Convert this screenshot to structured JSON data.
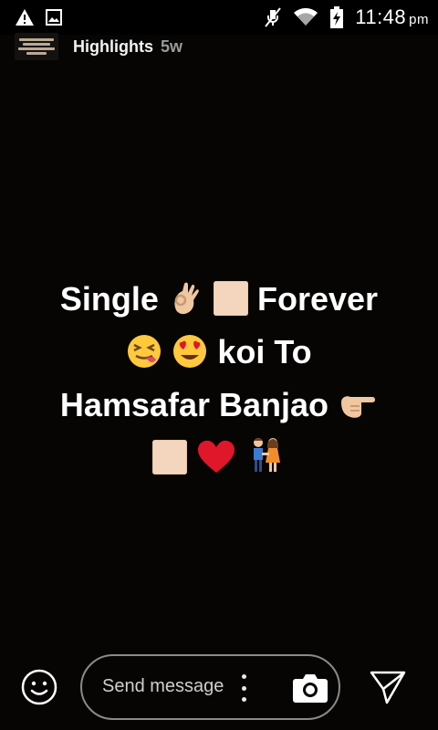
{
  "status_bar": {
    "time": "11:48",
    "ampm": "pm",
    "icons": [
      "warning-icon",
      "image-icon",
      "mute-icon",
      "wifi-icon",
      "battery-charging-icon"
    ]
  },
  "header": {
    "title": "Highlights",
    "age": "5w"
  },
  "story": {
    "line1_a": "Single",
    "line1_b": "Forever",
    "line2": "koi To",
    "line3": "Hamsafar Banjao"
  },
  "composer": {
    "placeholder": "Send message",
    "icons": [
      "smiley-icon",
      "more-vertical-icon",
      "camera-icon",
      "send-icon"
    ]
  },
  "colors": {
    "background": "#060504",
    "pill_border": "#8a8a8a",
    "skin_tone": "#f3d6bd",
    "heart": "#e0162b",
    "emoji_face": "#ffc83d"
  }
}
